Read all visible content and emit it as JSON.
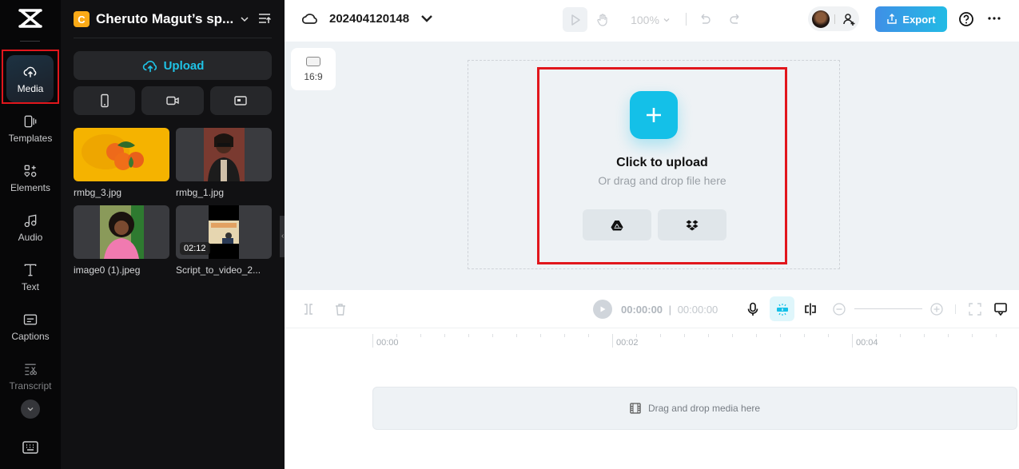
{
  "rail": {
    "items": [
      {
        "label": "Media",
        "icon": "cloud-upload-icon",
        "active": true
      },
      {
        "label": "Templates",
        "icon": "templates-icon"
      },
      {
        "label": "Elements",
        "icon": "elements-icon"
      },
      {
        "label": "Audio",
        "icon": "music-note-icon"
      },
      {
        "label": "Text",
        "icon": "text-icon"
      },
      {
        "label": "Captions",
        "icon": "captions-icon"
      },
      {
        "label": "Transcript",
        "icon": "transcript-icon"
      }
    ]
  },
  "panel": {
    "workspace_initial": "C",
    "workspace_name": "Cheruto Magut’s sp...",
    "upload_label": "Upload",
    "source_buttons": [
      "phone-icon",
      "camera-icon",
      "screen-record-icon"
    ],
    "media": [
      {
        "name": "rmbg_3.jpg",
        "kind": "image"
      },
      {
        "name": "rmbg_1.jpg",
        "kind": "image"
      },
      {
        "name": "image0 (1).jpeg",
        "kind": "image"
      },
      {
        "name": "Script_to_video_2...",
        "kind": "video",
        "duration": "02:12"
      }
    ]
  },
  "topbar": {
    "project_name": "202404120148",
    "zoom_level": "100%",
    "export_label": "Export"
  },
  "stage": {
    "aspect_ratio": "16:9",
    "upload_title": "Click to upload",
    "upload_subtitle": "Or drag and drop file here",
    "cloud_sources": [
      "google-drive-icon",
      "dropbox-icon"
    ]
  },
  "timeline": {
    "current_time": "00:00:00",
    "total_time": "00:00:00",
    "ruler_labels": [
      "00:00",
      "00:02",
      "00:04"
    ],
    "dropzone_text": "Drag and drop media here"
  },
  "colors": {
    "accent": "#14c0e8",
    "highlight": "#e1161c",
    "workspace_badge": "#fbaa17"
  }
}
